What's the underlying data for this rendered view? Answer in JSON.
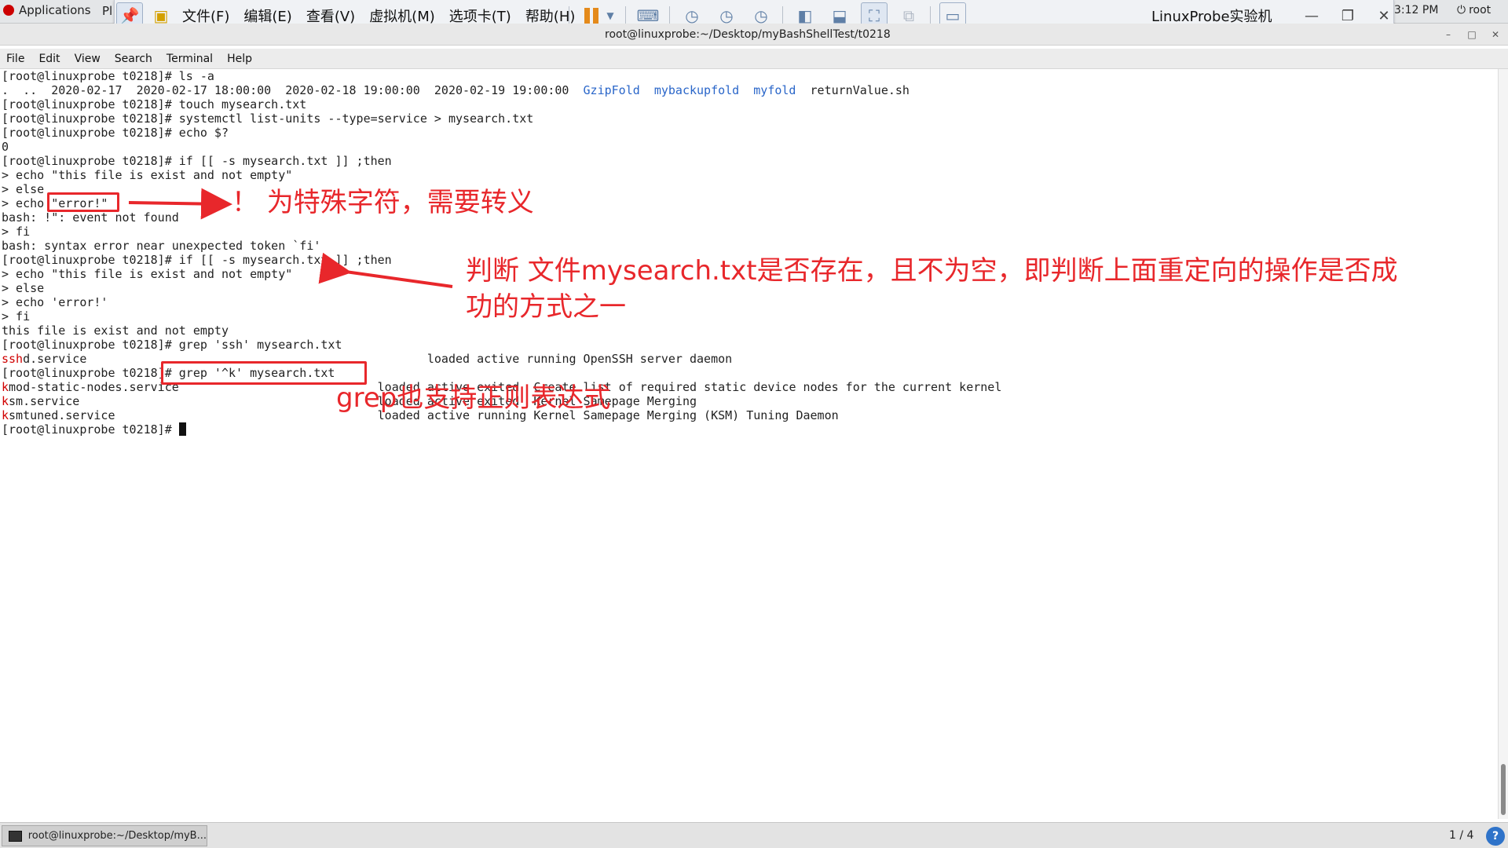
{
  "gnome_bar": {
    "applications": "Applications",
    "places": "Pl",
    "clock": "3:12 PM",
    "user": "root"
  },
  "vm_toolbar": {
    "menus": [
      "文件(F)",
      "编辑(E)",
      "查看(V)",
      "虚拟机(M)",
      "选项卡(T)",
      "帮助(H)"
    ],
    "vm_title": "LinuxProbe实验机"
  },
  "terminal_window": {
    "title": "root@linuxprobe:~/Desktop/myBashShellTest/t0218",
    "menu": [
      "File",
      "Edit",
      "View",
      "Search",
      "Terminal",
      "Help"
    ]
  },
  "terminal": {
    "lines": [
      "[root@linuxprobe t0218]# ls -a",
      "",
      "[root@linuxprobe t0218]# touch mysearch.txt",
      "[root@linuxprobe t0218]# systemctl list-units --type=service > mysearch.txt",
      "[root@linuxprobe t0218]# echo $?",
      "0",
      "[root@linuxprobe t0218]# if [[ -s mysearch.txt ]] ;then",
      "> echo \"this file is exist and not empty\"",
      "> else",
      "> echo \"error!\"",
      "bash: !\": event not found",
      "> fi",
      "bash: syntax error near unexpected token `fi'",
      "[root@linuxprobe t0218]# if [[ -s mysearch.txt ]] ;then",
      "> echo \"this file is exist and not empty\"",
      "> else",
      "> echo 'error!'",
      "> fi",
      "this file is exist and not empty",
      "[root@linuxprobe t0218]# grep 'ssh' mysearch.txt",
      "",
      "[root@linuxprobe t0218]# grep '^k' mysearch.txt",
      "",
      "",
      "",
      "[root@linuxprobe t0218]# "
    ],
    "ls_output": {
      "plain": ".  ..  2020-02-17  2020-02-17 18:00:00  2020-02-18 19:00:00  2020-02-19 19:00:00  ",
      "dirs": [
        "GzipFold",
        "mybackupfold",
        "myfold"
      ],
      "file": "returnValue.sh"
    },
    "matches": [
      {
        "hl": "ssh",
        "rest": "d.service",
        "pad": "                                                ",
        "desc": "loaded active running OpenSSH server daemon"
      },
      {
        "hl": "k",
        "rest": "mod-static-nodes.service",
        "pad": "                            ",
        "desc": "loaded active exited  Create list of required static device nodes for the current kernel"
      },
      {
        "hl": "k",
        "rest": "sm.service",
        "pad": "                                          ",
        "desc": "loaded active exited  Kernel Samepage Merging"
      },
      {
        "hl": "k",
        "rest": "smtuned.service",
        "pad": "                                     ",
        "desc": "loaded active running Kernel Samepage Merging (KSM) Tuning Daemon"
      }
    ]
  },
  "annotations": {
    "note1": "！ 为特殊字符，需要转义",
    "note2_line1": "判断 文件mysearch.txt是否存在，且不为空，即判断上面重定向的操作是否成",
    "note2_line2": "功的方式之一",
    "note3": "grep也支持正则表达式"
  },
  "taskbar": {
    "task": "root@linuxprobe:~/Desktop/myB...",
    "pager": "1 / 4",
    "help": "?"
  },
  "colors": {
    "annotation_red": "#e8272b",
    "directory_blue": "#2a66c9",
    "match_red": "#d00000"
  }
}
